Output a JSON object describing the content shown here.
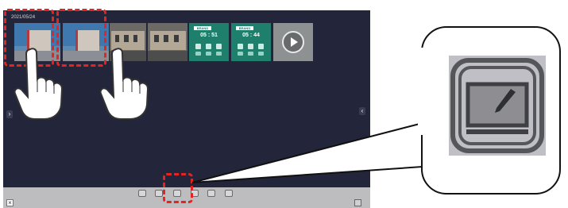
{
  "gallery": {
    "date": "2021/05/24",
    "clock_1": "05 : 51",
    "clock_2": "05 : 44",
    "brand_1": "BRAND",
    "brand_2": "BRAND"
  },
  "nav": {
    "left_arrow": "›",
    "right_arrow": "‹"
  },
  "toolbar": {
    "close_label": "×"
  },
  "icons": {
    "toolbar": [
      "home-icon",
      "gallery-icon",
      "edit-icon",
      "copy-icon",
      "check-icon",
      "settings-icon"
    ],
    "callout": "edit-icon"
  },
  "colors": {
    "highlight": "#e8231f",
    "screen_bg": "#23253a",
    "toolbar_bg": "#bdbdbf"
  }
}
